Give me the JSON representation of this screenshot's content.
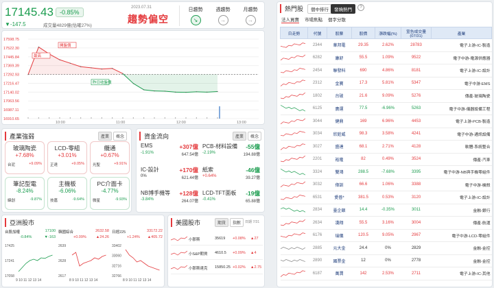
{
  "header": {
    "price": "17145.43",
    "pct": "-0.85%",
    "chg": "▼-147.5",
    "vol": "成交量4829億(估確27%)",
    "date": "2023.07.31",
    "trend": "趨勢偏空",
    "tabs": [
      "日趨勢",
      "週趨勢",
      "月趨勢"
    ],
    "tab_icons": [
      "trend-down-icon",
      "trend-flat-icon",
      "trend-flat-icon"
    ]
  },
  "chart": {
    "yticks": [
      "17598.75",
      "17522.30",
      "17445.84",
      "17369.39",
      "17292.93",
      "17216.47",
      "17140.02",
      "17063.56",
      "16987.11",
      "16910.65"
    ],
    "xticks": [
      "10:00",
      "11:00",
      "12:00",
      "13:00"
    ],
    "labels": {
      "high": "最高",
      "open": "開盤價",
      "prev": "昨日收盤價"
    },
    "line_color": "#e4393c",
    "area_color": "#1a9c4e"
  },
  "chart_data": {
    "type": "line",
    "xlabel": "",
    "ylabel": "",
    "ylim": [
      16910.65,
      17598.75
    ],
    "x": [
      "09:00",
      "09:15",
      "09:30",
      "09:45",
      "10:00",
      "10:15",
      "10:30",
      "10:45",
      "11:00",
      "11:15",
      "11:30",
      "11:45",
      "12:00",
      "12:15",
      "12:30",
      "12:45",
      "13:00",
      "13:15",
      "13:30"
    ],
    "y": [
      17292,
      17530,
      17470,
      17420,
      17390,
      17360,
      17350,
      17340,
      17345,
      17300,
      17215,
      17160,
      17150,
      17148,
      17140,
      17138,
      17143,
      17140,
      17145
    ],
    "reference": 17292.93
  },
  "sector": {
    "title": "產業強弱",
    "tabs": [
      "產業",
      "概念"
    ],
    "tiles": [
      {
        "name": "玻璃陶瓷",
        "val": "+7.68%",
        "s1": "台泥",
        "s2": "+9.09%",
        "dir": "up"
      },
      {
        "name": "LCD-零組",
        "val": "+3.01%",
        "s1": "正達",
        "s2": "+9.05%",
        "dir": "up"
      },
      {
        "name": "纜通",
        "val": "+0.67%",
        "s1": "光聖",
        "s2": "+9.91%",
        "dir": "up"
      },
      {
        "name": "筆記型電",
        "val": "-8.24%",
        "s1": "緯創",
        "s2": "-9.87%",
        "dir": "dn"
      },
      {
        "name": "主機板",
        "val": "-6.06%",
        "s1": "技嘉",
        "s2": "-9.64%",
        "dir": "dn"
      },
      {
        "name": "PC介面卡",
        "val": "-4.77%",
        "s1": "微星",
        "s2": "-9.93%",
        "dir": "dn"
      }
    ]
  },
  "flow": {
    "title": "資金流向",
    "tabs": [
      "產業",
      "概念"
    ],
    "items": [
      {
        "name": "EMS",
        "val": "+307億",
        "pct": "-1.91%",
        "amt": "647.54億",
        "dir": "up",
        "pdir": "dn"
      },
      {
        "name": "PCB-材料設備",
        "val": "-55億",
        "pct": "-2.19%",
        "amt": "194.88億",
        "dir": "dn",
        "pdir": "dn"
      },
      {
        "name": "IC-設計",
        "val": "+170億",
        "pct": "0%",
        "amt": "621.44億",
        "dir": "up",
        "pdir": "flat"
      },
      {
        "name": "紙索",
        "val": "-46億",
        "pct": "+0.64%",
        "amt": "39.27億",
        "dir": "dn",
        "pdir": "up"
      },
      {
        "name": "NB博手機等",
        "val": "+128億",
        "pct": "-3.84%",
        "amt": "264.07億",
        "dir": "up",
        "pdir": "dn"
      },
      {
        "name": "LCD-TFT面板",
        "val": "-19億",
        "pct": "-0.41%",
        "amt": "65.88億",
        "dir": "dn",
        "pdir": "dn"
      }
    ]
  },
  "asia": {
    "title": "亞洲股市",
    "charts": [
      {
        "name": "台股加權",
        "val": "17100",
        "pct": "-0.84%",
        "chg": "▼-163",
        "dir": "dn",
        "yt": [
          "17425",
          "17241",
          "17058"
        ],
        "xt": "9  10  11  12  13  14"
      },
      {
        "name": "韓國綜合",
        "val": "2632.58",
        "pct": "+0.09%",
        "chg": "▲24.26",
        "dir": "up",
        "yt": [
          "2639",
          "2628",
          "2617"
        ],
        "xt": "8  9  10  11  12  13  14"
      },
      {
        "name": "日經225",
        "val": "33172.22",
        "pct": "+1.24%",
        "chg": "▲405.72",
        "dir": "up",
        "yt": [
          "33402",
          "33060",
          "32716",
          "32766"
        ],
        "xt": "8  9  10  11  12  13  14"
      }
    ]
  },
  "us": {
    "title": "美國股市",
    "tabs": [
      "期貨",
      "指數"
    ],
    "time": "日期 7/31",
    "rows": [
      {
        "name": "小那斯",
        "val": "35619",
        "pct": "+0.08%",
        "chg": "▲27"
      },
      {
        "name": "小S&P期貨",
        "val": "4610.5",
        "pct": "+0.09%",
        "chg": "▲4"
      },
      {
        "name": "小那斯達克",
        "val": "15850.25",
        "pct": "+0.02%",
        "chg": "▲2.75"
      }
    ]
  },
  "hot": {
    "title": "熱門股",
    "main_tabs": [
      "個中排行",
      "發燒熱門"
    ],
    "sub_tabs": [
      "法人買賣",
      "市場焦點",
      "個字分散"
    ],
    "cols": [
      "日走勢",
      "代號",
      "股票",
      "股價",
      "漲跌幅(%)",
      "宣告成交量\n(07/31)",
      "產業"
    ],
    "rows": [
      {
        "code": "2344",
        "name": "華邦電",
        "price": "29.35",
        "pct": "2.62%",
        "vol": "28783",
        "ind": "電子上游-IC-製造",
        "dir": "up"
      },
      {
        "code": "6282",
        "name": "康舒",
        "price": "55.5",
        "pct": "1.09%",
        "vol": "9522",
        "ind": "電子中游-電源供應器",
        "dir": "up"
      },
      {
        "code": "2454",
        "name": "聯發科",
        "price": "690",
        "pct": "4.86%",
        "vol": "8181",
        "ind": "電子上游-IC-設計",
        "dir": "up"
      },
      {
        "code": "2312",
        "name": "金寶",
        "price": "17.3",
        "pct": "5.81%",
        "vol": "5347",
        "ind": "電子中游-EMS",
        "dir": "up"
      },
      {
        "code": "1802",
        "name": "台玻",
        "price": "21.6",
        "pct": "9.09%",
        "vol": "5276",
        "ind": "傳產-玻璃陶瓷",
        "dir": "up"
      },
      {
        "code": "6125",
        "name": "廣運",
        "price": "77.5",
        "pct": "-6.96%",
        "vol": "5263",
        "ind": "電子中游-儀器設備工程",
        "dir": "dn"
      },
      {
        "code": "3044",
        "name": "健鼎",
        "price": "169",
        "pct": "6.96%",
        "vol": "4453",
        "ind": "電子上游-PCB-製造",
        "dir": "up"
      },
      {
        "code": "3034",
        "name": "欣銓威",
        "price": "98.3",
        "pct": "3.58%",
        "vol": "4241",
        "ind": "電子中游-通訊設備",
        "dir": "up"
      },
      {
        "code": "3027",
        "name": "盛達",
        "price": "68.1",
        "pct": "2.71%",
        "vol": "4128",
        "ind": "軟體-系統整合",
        "dir": "up"
      },
      {
        "code": "2201",
        "name": "裕隆",
        "price": "82",
        "pct": "0.49%",
        "vol": "3524",
        "ind": "傳產-汽車",
        "dir": "up"
      },
      {
        "code": "3324",
        "name": "雙鴻",
        "price": "288.5",
        "pct": "-7.68%",
        "vol": "3395",
        "ind": "電子中游-NB與手機零組件",
        "dir": "dn"
      },
      {
        "code": "3032",
        "name": "偉訓",
        "price": "66.6",
        "pct": "1.06%",
        "vol": "3388",
        "ind": "電子中游-機殼",
        "dir": "up"
      },
      {
        "code": "6531",
        "name": "愛普*",
        "price": "381.5",
        "pct": "0.53%",
        "vol": "3120",
        "ind": "電子上游-IC-設計",
        "dir": "up"
      },
      {
        "code": "2834",
        "name": "臺企銀",
        "price": "14.4",
        "pct": "-0.35%",
        "vol": "3011",
        "ind": "金融-銀行",
        "dir": "dn"
      },
      {
        "code": "2634",
        "name": "漢翔",
        "price": "55.5",
        "pct": "3.16%",
        "vol": "3004",
        "ind": "傳產-航運",
        "dir": "up"
      },
      {
        "code": "6176",
        "name": "瑞儀",
        "price": "120.5",
        "pct": "9.05%",
        "vol": "2967",
        "ind": "電子中游-LCD-零組件",
        "dir": "up"
      },
      {
        "code": "2885",
        "name": "元大金",
        "price": "24.4",
        "pct": "0%",
        "vol": "2829",
        "ind": "金融-金控",
        "dir": "flat"
      },
      {
        "code": "2890",
        "name": "國票金",
        "price": "12",
        "pct": "0%",
        "vol": "2778",
        "ind": "金融-金控",
        "dir": "flat"
      },
      {
        "code": "6187",
        "name": "萬潤",
        "price": "142",
        "pct": "2.53%",
        "vol": "2711",
        "ind": "電子上游-IC-其他",
        "dir": "up"
      }
    ]
  }
}
